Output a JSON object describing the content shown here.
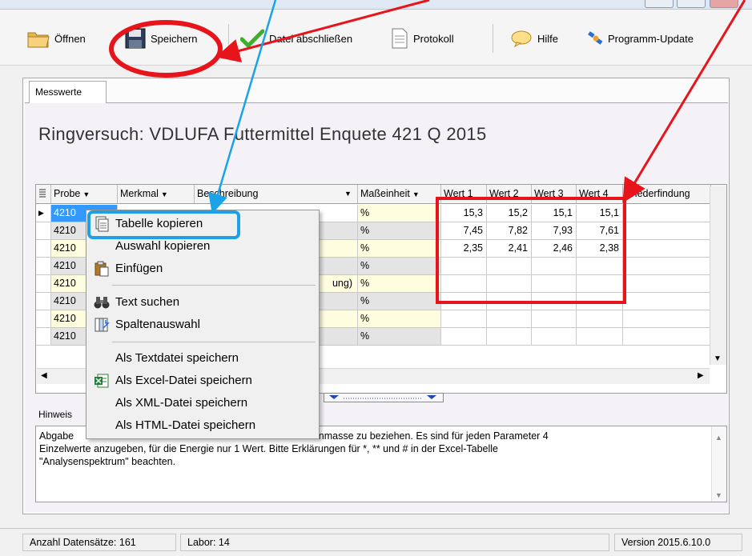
{
  "toolbar": {
    "open_label": "Öffnen",
    "save_label": "Speichern",
    "close_file_label": "Datei abschließen",
    "protocol_label": "Protokoll",
    "help_label": "Hilfe",
    "update_label": "Programm-Update"
  },
  "tab": {
    "label": "Messwerte"
  },
  "page_title": "Ringversuch: VDLUFA Futtermittel Enquete 421 Q 2015",
  "grid": {
    "columns": [
      "Probe",
      "Merkmal",
      "Beschreibung",
      "Maßeinheit",
      "Wert 1",
      "Wert 2",
      "Wert 3",
      "Wert 4",
      "Wiederfindung"
    ],
    "rows": [
      {
        "probe": "4210",
        "einheit": "%",
        "w1": "15,3",
        "w2": "15,2",
        "w3": "15,1",
        "w4": "15,1"
      },
      {
        "probe": "4210",
        "einheit": "%",
        "w1": "7,45",
        "w2": "7,82",
        "w3": "7,93",
        "w4": "7,61"
      },
      {
        "probe": "4210",
        "einheit": "%",
        "w1": "2,35",
        "w2": "2,41",
        "w3": "2,46",
        "w4": "2,38"
      },
      {
        "probe": "4210",
        "einheit": "%",
        "w1": "",
        "w2": "",
        "w3": "",
        "w4": ""
      },
      {
        "probe": "4210",
        "beschreibung_fragment": "ung)",
        "einheit": "%",
        "w1": "",
        "w2": "",
        "w3": "",
        "w4": ""
      },
      {
        "probe": "4210",
        "einheit": "%",
        "w1": "",
        "w2": "",
        "w3": "",
        "w4": ""
      },
      {
        "probe": "4210",
        "einheit": "%",
        "w1": "",
        "w2": "",
        "w3": "",
        "w4": ""
      },
      {
        "probe": "4210",
        "einheit": "%",
        "w1": "",
        "w2": "",
        "w3": "",
        "w4": ""
      }
    ]
  },
  "context_menu": {
    "items": [
      "Tabelle kopieren",
      "Auswahl kopieren",
      "Einfügen",
      "Text suchen",
      "Spaltenauswahl",
      "Als Textdatei speichern",
      "Als Excel-Datei speichern",
      "Als XML-Datei speichern",
      "Als HTML-Datei speichern"
    ]
  },
  "hints": {
    "label": "Hinweis",
    "text_visible_start": "Abgabe",
    "text_line1": "die  Trockenmasse zu beziehen. Es sind für  jeden Parameter 4",
    "text_line2": "Einzelwerte  anzugeben, für  die Energie nur 1 Wert. Bitte Erklärungen  für *, ** und # in der Excel-Tabelle",
    "text_line3": "\"Analysenspektrum\" beachten."
  },
  "statusbar": {
    "records": "Anzahl Datensätze: 161",
    "lab": "Labor: 14",
    "version": "Version 2015.6.10.0"
  },
  "colors": {
    "annotation_red": "#e8141c",
    "annotation_blue": "#1aa3e8",
    "menu_highlight": "#1fa0e6",
    "yellow_cell": "#fffde0",
    "selected_cell": "#3399ff"
  },
  "icons": [
    "folder-icon",
    "floppy-disk-icon",
    "checkmark-icon",
    "document-icon",
    "speech-bubble-icon",
    "satellite-update-icon",
    "copy-table-icon",
    "paste-icon",
    "binoculars-icon",
    "column-select-icon",
    "excel-icon"
  ]
}
